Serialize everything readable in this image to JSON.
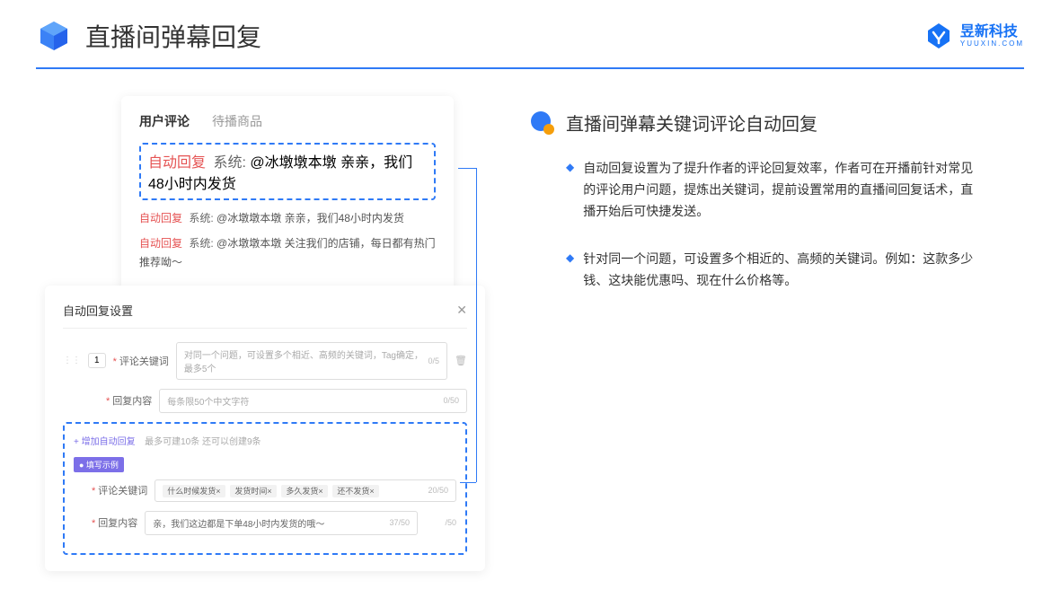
{
  "header": {
    "title": "直播间弹幕回复",
    "logo_cn": "昱新科技",
    "logo_en": "YUUXIN.COM"
  },
  "card_upper": {
    "tab_active": "用户评论",
    "tab_inactive": "待播商品",
    "highlighted": {
      "label": "自动回复",
      "system": "系统:",
      "text": "@冰墩墩本墩 亲亲，我们48小时内发货"
    },
    "comments": [
      {
        "label": "自动回复",
        "system": "系统:",
        "text": "@冰墩墩本墩 亲亲，我们48小时内发货"
      },
      {
        "label": "自动回复",
        "system": "系统:",
        "text": "@冰墩墩本墩 关注我们的店铺，每日都有热门推荐呦～"
      }
    ]
  },
  "card_lower": {
    "title": "自动回复设置",
    "row_num": "1",
    "keyword_label": "评论关键词",
    "keyword_placeholder": "对同一个问题，可设置多个相近、高频的关键词，Tag确定，最多5个",
    "keyword_counter": "0/5",
    "content_label": "回复内容",
    "content_placeholder": "每条限50个中文字符",
    "content_counter": "0/50",
    "add_link": "+ 增加自动回复",
    "add_hint": "最多可建10条 还可以创建9条",
    "example_badge": "● 填写示例",
    "example_keyword_label": "评论关键词",
    "example_tags": [
      "什么时候发货×",
      "发货时间×",
      "多久发货×",
      "还不发货×"
    ],
    "example_keyword_counter": "20/50",
    "example_content_label": "回复内容",
    "example_content_text": "亲，我们这边都是下单48小时内发货的哦～",
    "example_content_counter": "37/50",
    "trailing_counter": "/50"
  },
  "right": {
    "section_title": "直播间弹幕关键词评论自动回复",
    "bullets": [
      "自动回复设置为了提升作者的评论回复效率，作者可在开播前针对常见的评论用户问题，提炼出关键词，提前设置常用的直播间回复话术，直播开始后可快捷发送。",
      "针对同一个问题，可设置多个相近的、高频的关键词。例如：这款多少钱、这块能优惠吗、现在什么价格等。"
    ]
  }
}
